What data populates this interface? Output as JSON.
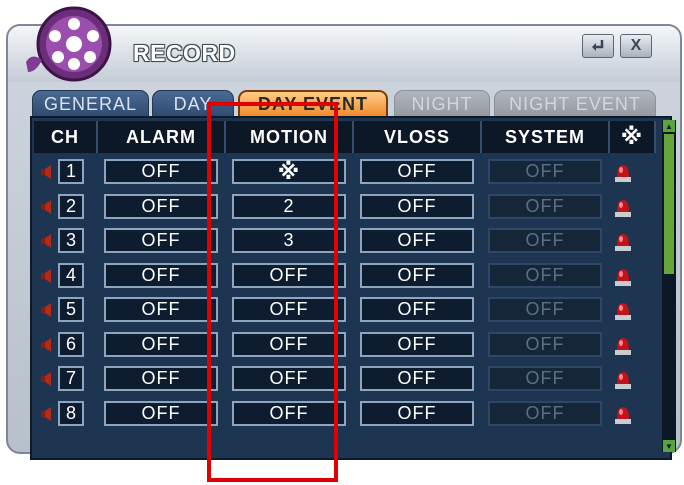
{
  "window": {
    "title": "RECORD",
    "enter_icon": "enter-icon",
    "close_label": "X"
  },
  "tabs": [
    {
      "label": "GENERAL",
      "state": "normal"
    },
    {
      "label": "DAY",
      "state": "normal"
    },
    {
      "label": "DAY EVENT",
      "state": "active"
    },
    {
      "label": "NIGHT",
      "state": "disabled"
    },
    {
      "label": "NIGHT EVENT",
      "state": "disabled"
    }
  ],
  "headers": {
    "ch": "CH",
    "alarm": "ALARM",
    "motion": "MOTION",
    "vloss": "VLOSS",
    "system": "SYSTEM",
    "all": "※"
  },
  "rows": [
    {
      "ch": "1",
      "alarm": "OFF",
      "motion": "※",
      "vloss": "OFF",
      "system": "OFF"
    },
    {
      "ch": "2",
      "alarm": "OFF",
      "motion": "2",
      "vloss": "OFF",
      "system": "OFF"
    },
    {
      "ch": "3",
      "alarm": "OFF",
      "motion": "3",
      "vloss": "OFF",
      "system": "OFF"
    },
    {
      "ch": "4",
      "alarm": "OFF",
      "motion": "OFF",
      "vloss": "OFF",
      "system": "OFF"
    },
    {
      "ch": "5",
      "alarm": "OFF",
      "motion": "OFF",
      "vloss": "OFF",
      "system": "OFF"
    },
    {
      "ch": "6",
      "alarm": "OFF",
      "motion": "OFF",
      "vloss": "OFF",
      "system": "OFF"
    },
    {
      "ch": "7",
      "alarm": "OFF",
      "motion": "OFF",
      "vloss": "OFF",
      "system": "OFF"
    },
    {
      "ch": "8",
      "alarm": "OFF",
      "motion": "OFF",
      "vloss": "OFF",
      "system": "OFF"
    }
  ],
  "icons": {
    "speaker": "speaker-icon",
    "alarm_light": "alarm-light-icon",
    "logo": "film-reel-logo"
  },
  "colors": {
    "active_tab": "#f08a2c",
    "highlight": "#e10000",
    "panel": "#1d3550",
    "scroll": "#67a53a"
  }
}
